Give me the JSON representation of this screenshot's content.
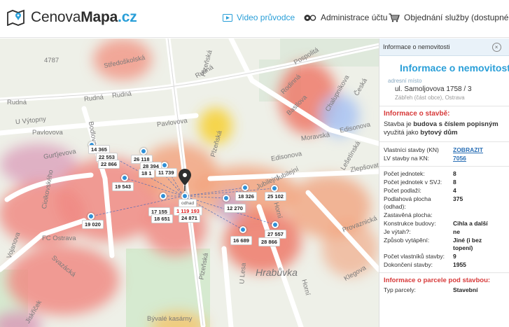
{
  "header": {
    "logo_main": "Cenova",
    "logo_bold": "Mapa",
    "logo_tld": ".cz",
    "nav": [
      {
        "label": "Video průvodce",
        "icon": "video-play-icon"
      },
      {
        "label": "Administrace účtu",
        "icon": "account-toggle-icon"
      },
      {
        "label": "Objednání služby (dostupné",
        "icon": "shopping-cart-icon"
      }
    ],
    "accent_color": "#2a9fd8"
  },
  "map": {
    "street_labels": [
      "4787",
      "Středoškolská",
      "Rudná",
      "Rudná",
      "Rudná",
      "Rudná",
      "U Výtopny",
      "Pavlovova",
      "Pavlovova",
      "Plzeňská",
      "Plzeňská",
      "Plzeňská",
      "Pospolitá",
      "Rodinná",
      "Bastlova",
      "Chalupníkova",
      "Moravská",
      "Česká",
      "Edisonova",
      "Edisonova",
      "Gurťjevova",
      "Jubilejní",
      "Jubilejní",
      "Lešetínská",
      "Zlepšovatelů",
      "Svazácká",
      "Horní",
      "Horní",
      "Provaznická",
      "Klegova",
      "U Lesa",
      "Hrabůvka",
      "Bývalé kasárny",
      "FC Ostrava",
      "Jiskřiček",
      "Ciolkovského",
      "Vojanova",
      "Bodlova"
    ],
    "markers": [
      {
        "price": "14 365"
      },
      {
        "price": "22 553"
      },
      {
        "price": "22 866"
      },
      {
        "price": "26 118"
      },
      {
        "price": "28 394"
      },
      {
        "price": "18 1"
      },
      {
        "price": "11 739"
      },
      {
        "price": "19 543"
      },
      {
        "price": "17 155"
      },
      {
        "price": "18 651"
      },
      {
        "price": "odhad"
      },
      {
        "price": "1 119 193"
      },
      {
        "price": "24 871"
      },
      {
        "price": "18 326"
      },
      {
        "price": "25 102"
      },
      {
        "price": "12 270"
      },
      {
        "price": "19 020"
      },
      {
        "price": "16 689"
      },
      {
        "price": "27 557"
      },
      {
        "price": "28 866"
      }
    ]
  },
  "panel": {
    "header": "Informace o nemovitosti",
    "title": "Informace o nemovitosti",
    "addr_label": "adresní místo",
    "addr_line": "ul. Samoljovova 1758 / 3",
    "addr_sub": "Zábřeh (část obce), Ostrava",
    "building_title": "Informace o stavbě:",
    "building_text_1": "Stavba je ",
    "building_text_bold_1": "budova s číslem popisným",
    "building_text_2": " využitá jako ",
    "building_text_bold_2": "bytový dům",
    "owner_rows": [
      {
        "k": "Vlastníci stavby (KN)",
        "v": "ZOBRAZIT"
      },
      {
        "k": "LV stavby na KN:",
        "v": "7056"
      }
    ],
    "detail_rows": [
      {
        "k": "Počet jednotek:",
        "v": "8"
      },
      {
        "k": "Počet jednotek v SVJ:",
        "v": "8"
      },
      {
        "k": "Počet podlaží:",
        "v": "4"
      },
      {
        "k": "Podlahová plocha (odhad):",
        "v": "375"
      },
      {
        "k": "Zastavěná plocha:",
        "v": ""
      },
      {
        "k": "Konstrukce budovy:",
        "v": "Cihla a další"
      },
      {
        "k": "Je výtah?:",
        "v": "ne"
      },
      {
        "k": "Způsob vytápění:",
        "v": "Jiné (i bez topení)"
      },
      {
        "k": "Počet vlastníků stavby:",
        "v": "9"
      },
      {
        "k": "Dokončení stavby:",
        "v": "1955"
      }
    ],
    "parcel_title": "Informace o parcele pod stavbou:",
    "parcel_rows": [
      {
        "k": "Typ parcely:",
        "v": "Stavební"
      }
    ]
  }
}
